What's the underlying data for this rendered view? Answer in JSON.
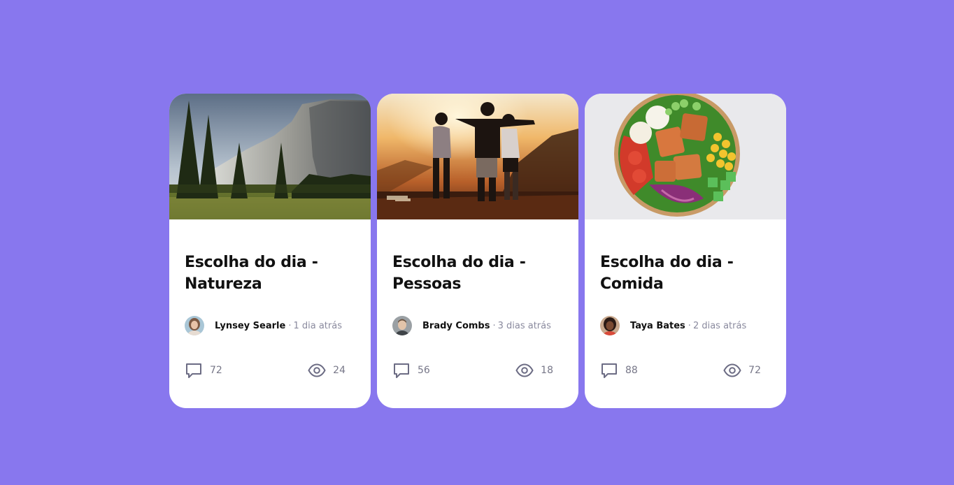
{
  "cards": [
    {
      "title_line1": "Escolha do dia -",
      "title_line2": "Natureza",
      "author": "Lynsey Searle",
      "separator": "·",
      "time": "1 dia atrás",
      "comments": "72",
      "views": "24"
    },
    {
      "title_line1": "Escolha do dia -",
      "title_line2": "Pessoas",
      "author": "Brady Combs",
      "separator": "·",
      "time": "3 dias atrás",
      "comments": "56",
      "views": "18"
    },
    {
      "title_line1": "Escolha do dia -",
      "title_line2": "Comida",
      "author": "Taya Bates",
      "separator": "·",
      "time": "2 dias atrás",
      "comments": "88",
      "views": "72"
    }
  ],
  "icons": {
    "comment": "comment-icon",
    "views": "eye-icon"
  },
  "colors": {
    "background": "#8877ee",
    "card": "#ffffff",
    "title": "#111111",
    "muted": "#8a8a9e"
  }
}
